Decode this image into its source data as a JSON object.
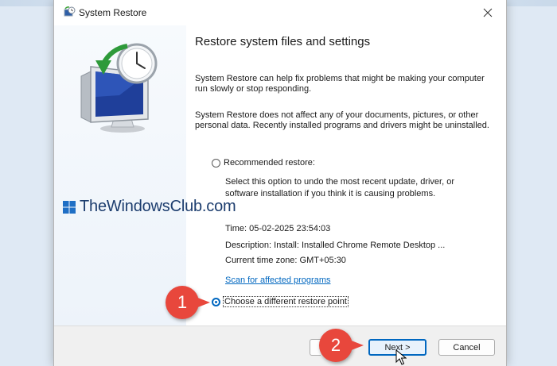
{
  "window": {
    "title": "System Restore",
    "icon": "system-restore-icon",
    "close_icon": "close-icon"
  },
  "left_panel": {
    "hero_icon": "monitor-clock-restore-icon",
    "watermark": "TheWindowsClub.com"
  },
  "content": {
    "heading": "Restore system files and settings",
    "para1": "System Restore can help fix problems that might be making your computer run slowly or stop responding.",
    "para2": "System Restore does not affect any of your documents, pictures, or other personal data. Recently installed programs and drivers might be uninstalled.",
    "recommended": {
      "label": "Recommended restore:",
      "selected": false,
      "description": "Select this option to undo the most recent update, driver, or software installation if you think it is causing problems."
    },
    "time": "Time: 05-02-2025 23:54:03",
    "description": "Description: Install: Installed Chrome Remote Desktop ...",
    "timezone": "Current time zone: GMT+05:30",
    "scan_link": "Scan for affected programs",
    "different": {
      "label": "Choose a different restore point",
      "selected": true
    }
  },
  "footer": {
    "next_label": "Next >",
    "cancel_label": "Cancel"
  },
  "annotations": {
    "step1": "1",
    "step2": "2"
  },
  "colors": {
    "accent": "#0067c0",
    "badge": "#e8473c",
    "link": "#0067c0"
  }
}
